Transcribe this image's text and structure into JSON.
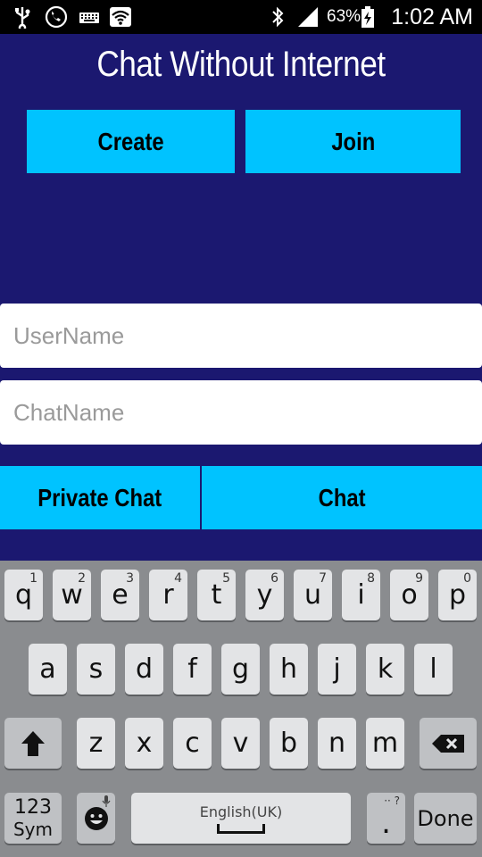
{
  "status_bar": {
    "battery": "63%",
    "time": "1:02 AM",
    "icons": [
      "usb-icon",
      "call-icon",
      "keyboard-icon",
      "wifi-icon",
      "bluetooth-icon",
      "signal-icon",
      "battery-charging-icon"
    ]
  },
  "app": {
    "title": "Chat Without Internet",
    "create_label": "Create",
    "join_label": "Join",
    "username_placeholder": "UserName",
    "chatname_placeholder": "ChatName",
    "private_chat_label": "Private Chat",
    "chat_label": "Chat"
  },
  "keyboard": {
    "row1": [
      {
        "key": "q",
        "sub": "1"
      },
      {
        "key": "w",
        "sub": "2"
      },
      {
        "key": "e",
        "sub": "3"
      },
      {
        "key": "r",
        "sub": "4"
      },
      {
        "key": "t",
        "sub": "5"
      },
      {
        "key": "y",
        "sub": "6"
      },
      {
        "key": "u",
        "sub": "7"
      },
      {
        "key": "i",
        "sub": "8"
      },
      {
        "key": "o",
        "sub": "9"
      },
      {
        "key": "p",
        "sub": "0"
      }
    ],
    "row2": [
      "a",
      "s",
      "d",
      "f",
      "g",
      "h",
      "j",
      "k",
      "l"
    ],
    "row3": [
      "z",
      "x",
      "c",
      "v",
      "b",
      "n",
      "m"
    ],
    "sym_top": "123",
    "sym_bottom": "Sym",
    "space_label": "English(UK)",
    "period": ".",
    "period_sub": "·· ?",
    "done": "Done"
  },
  "colors": {
    "background": "#1b1870",
    "button": "#00c3ff",
    "keyboard": "#8a8c8f"
  }
}
